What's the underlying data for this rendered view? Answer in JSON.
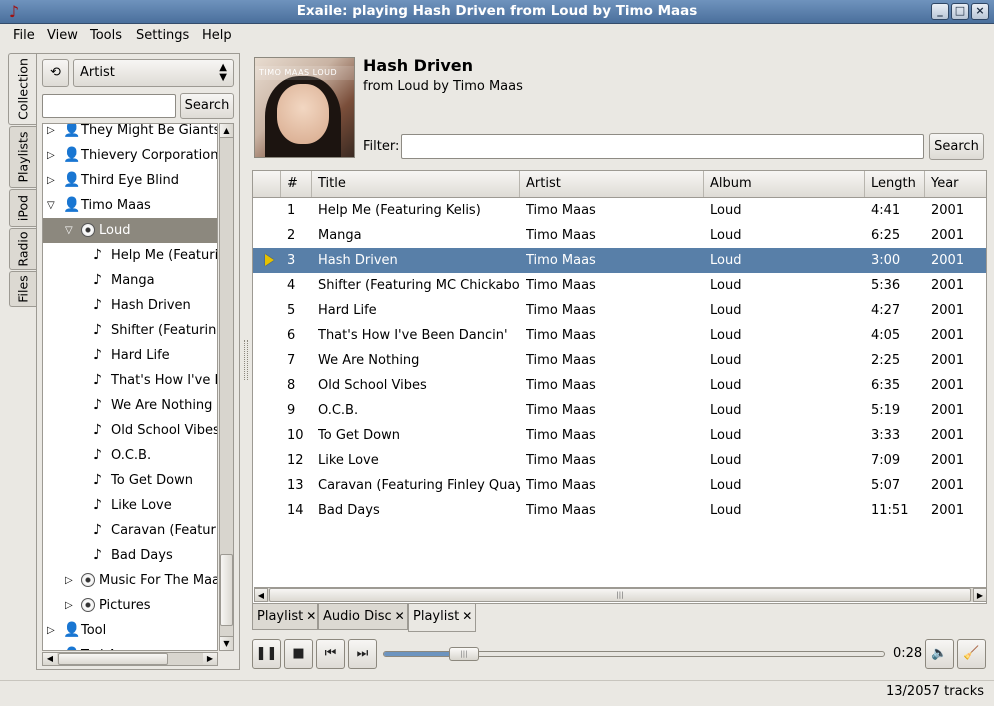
{
  "window": {
    "title": "Exaile: playing Hash Driven from Loud by Timo Maas"
  },
  "menu": [
    "File",
    "View",
    "Tools",
    "Settings",
    "Help"
  ],
  "side_tabs": [
    "Collection",
    "Playlists",
    "iPod",
    "Radio",
    "Files"
  ],
  "collection": {
    "view_mode": "Artist",
    "search_value": "",
    "search_button": "Search",
    "tree": [
      {
        "label": "They Might Be Giants",
        "kind": "artist",
        "level": 0,
        "expander": "collapsed"
      },
      {
        "label": "Thievery Corporation",
        "kind": "artist",
        "level": 0,
        "expander": "collapsed"
      },
      {
        "label": "Third Eye Blind",
        "kind": "artist",
        "level": 0,
        "expander": "collapsed"
      },
      {
        "label": "Timo Maas",
        "kind": "artist",
        "level": 0,
        "expander": "expanded"
      },
      {
        "label": "Loud",
        "kind": "album",
        "level": 1,
        "expander": "expanded",
        "selected": true
      },
      {
        "label": "Help Me (Featuring Kelis)",
        "kind": "track",
        "level": 2
      },
      {
        "label": "Manga",
        "kind": "track",
        "level": 2
      },
      {
        "label": "Hash Driven",
        "kind": "track",
        "level": 2
      },
      {
        "label": "Shifter (Featuring MC Chickaboo)",
        "kind": "track",
        "level": 2
      },
      {
        "label": "Hard Life",
        "kind": "track",
        "level": 2
      },
      {
        "label": "That's How I've Been Dancin'",
        "kind": "track",
        "level": 2
      },
      {
        "label": "We Are Nothing",
        "kind": "track",
        "level": 2
      },
      {
        "label": "Old School Vibes",
        "kind": "track",
        "level": 2
      },
      {
        "label": "O.C.B.",
        "kind": "track",
        "level": 2
      },
      {
        "label": "To Get Down",
        "kind": "track",
        "level": 2
      },
      {
        "label": "Like Love",
        "kind": "track",
        "level": 2
      },
      {
        "label": "Caravan (Featuring Finley Quaye)",
        "kind": "track",
        "level": 2
      },
      {
        "label": "Bad Days",
        "kind": "track",
        "level": 2
      },
      {
        "label": "Music For The Maases",
        "kind": "album",
        "level": 1,
        "expander": "collapsed"
      },
      {
        "label": "Pictures",
        "kind": "album",
        "level": 1,
        "expander": "collapsed"
      },
      {
        "label": "Tool",
        "kind": "artist",
        "level": 0,
        "expander": "collapsed"
      },
      {
        "label": "Tori Amos",
        "kind": "artist",
        "level": 0,
        "expander": "collapsed"
      }
    ]
  },
  "now_playing": {
    "cover_text": "TIMO MAAS LOUD",
    "title": "Hash Driven",
    "subtitle": "from Loud by Timo Maas"
  },
  "filter": {
    "label": "Filter:",
    "value": "",
    "button": "Search"
  },
  "tracklist": {
    "columns": [
      "",
      "#",
      "Title",
      "Artist",
      "Album",
      "Length",
      "Year"
    ],
    "rows": [
      {
        "num": "1",
        "title": "Help Me (Featuring Kelis)",
        "artist": "Timo Maas",
        "album": "Loud",
        "length": "4:41",
        "year": "2001"
      },
      {
        "num": "2",
        "title": "Manga",
        "artist": "Timo Maas",
        "album": "Loud",
        "length": "6:25",
        "year": "2001"
      },
      {
        "num": "3",
        "title": "Hash Driven",
        "artist": "Timo Maas",
        "album": "Loud",
        "length": "3:00",
        "year": "2001",
        "playing": true
      },
      {
        "num": "4",
        "title": "Shifter (Featuring MC Chickaboo)",
        "artist": "Timo Maas",
        "album": "Loud",
        "length": "5:36",
        "year": "2001"
      },
      {
        "num": "5",
        "title": "Hard Life",
        "artist": "Timo Maas",
        "album": "Loud",
        "length": "4:27",
        "year": "2001"
      },
      {
        "num": "6",
        "title": "That's How I've Been Dancin'",
        "artist": "Timo Maas",
        "album": "Loud",
        "length": "4:05",
        "year": "2001"
      },
      {
        "num": "7",
        "title": "We Are Nothing",
        "artist": "Timo Maas",
        "album": "Loud",
        "length": "2:25",
        "year": "2001"
      },
      {
        "num": "8",
        "title": "Old School Vibes",
        "artist": "Timo Maas",
        "album": "Loud",
        "length": "6:35",
        "year": "2001"
      },
      {
        "num": "9",
        "title": "O.C.B.",
        "artist": "Timo Maas",
        "album": "Loud",
        "length": "5:19",
        "year": "2001"
      },
      {
        "num": "10",
        "title": "To Get Down",
        "artist": "Timo Maas",
        "album": "Loud",
        "length": "3:33",
        "year": "2001"
      },
      {
        "num": "12",
        "title": "Like Love",
        "artist": "Timo Maas",
        "album": "Loud",
        "length": "7:09",
        "year": "2001"
      },
      {
        "num": "13",
        "title": "Caravan (Featuring Finley Quaye)",
        "artist": "Timo Maas",
        "album": "Loud",
        "length": "5:07",
        "year": "2001"
      },
      {
        "num": "14",
        "title": "Bad Days",
        "artist": "Timo Maas",
        "album": "Loud",
        "length": "11:51",
        "year": "2001"
      }
    ]
  },
  "playlist_tabs": [
    {
      "label": "Playlist",
      "active": false
    },
    {
      "label": "Audio Disc",
      "active": false
    },
    {
      "label": "Playlist",
      "active": true
    }
  ],
  "player": {
    "elapsed": "0:28",
    "progress_fraction": 0.16
  },
  "status": {
    "track_count": "13/2057 tracks"
  },
  "colors": {
    "selection": "#587fa8",
    "titlebar": "#5a7fab",
    "play_indicator": "#e6c200"
  }
}
